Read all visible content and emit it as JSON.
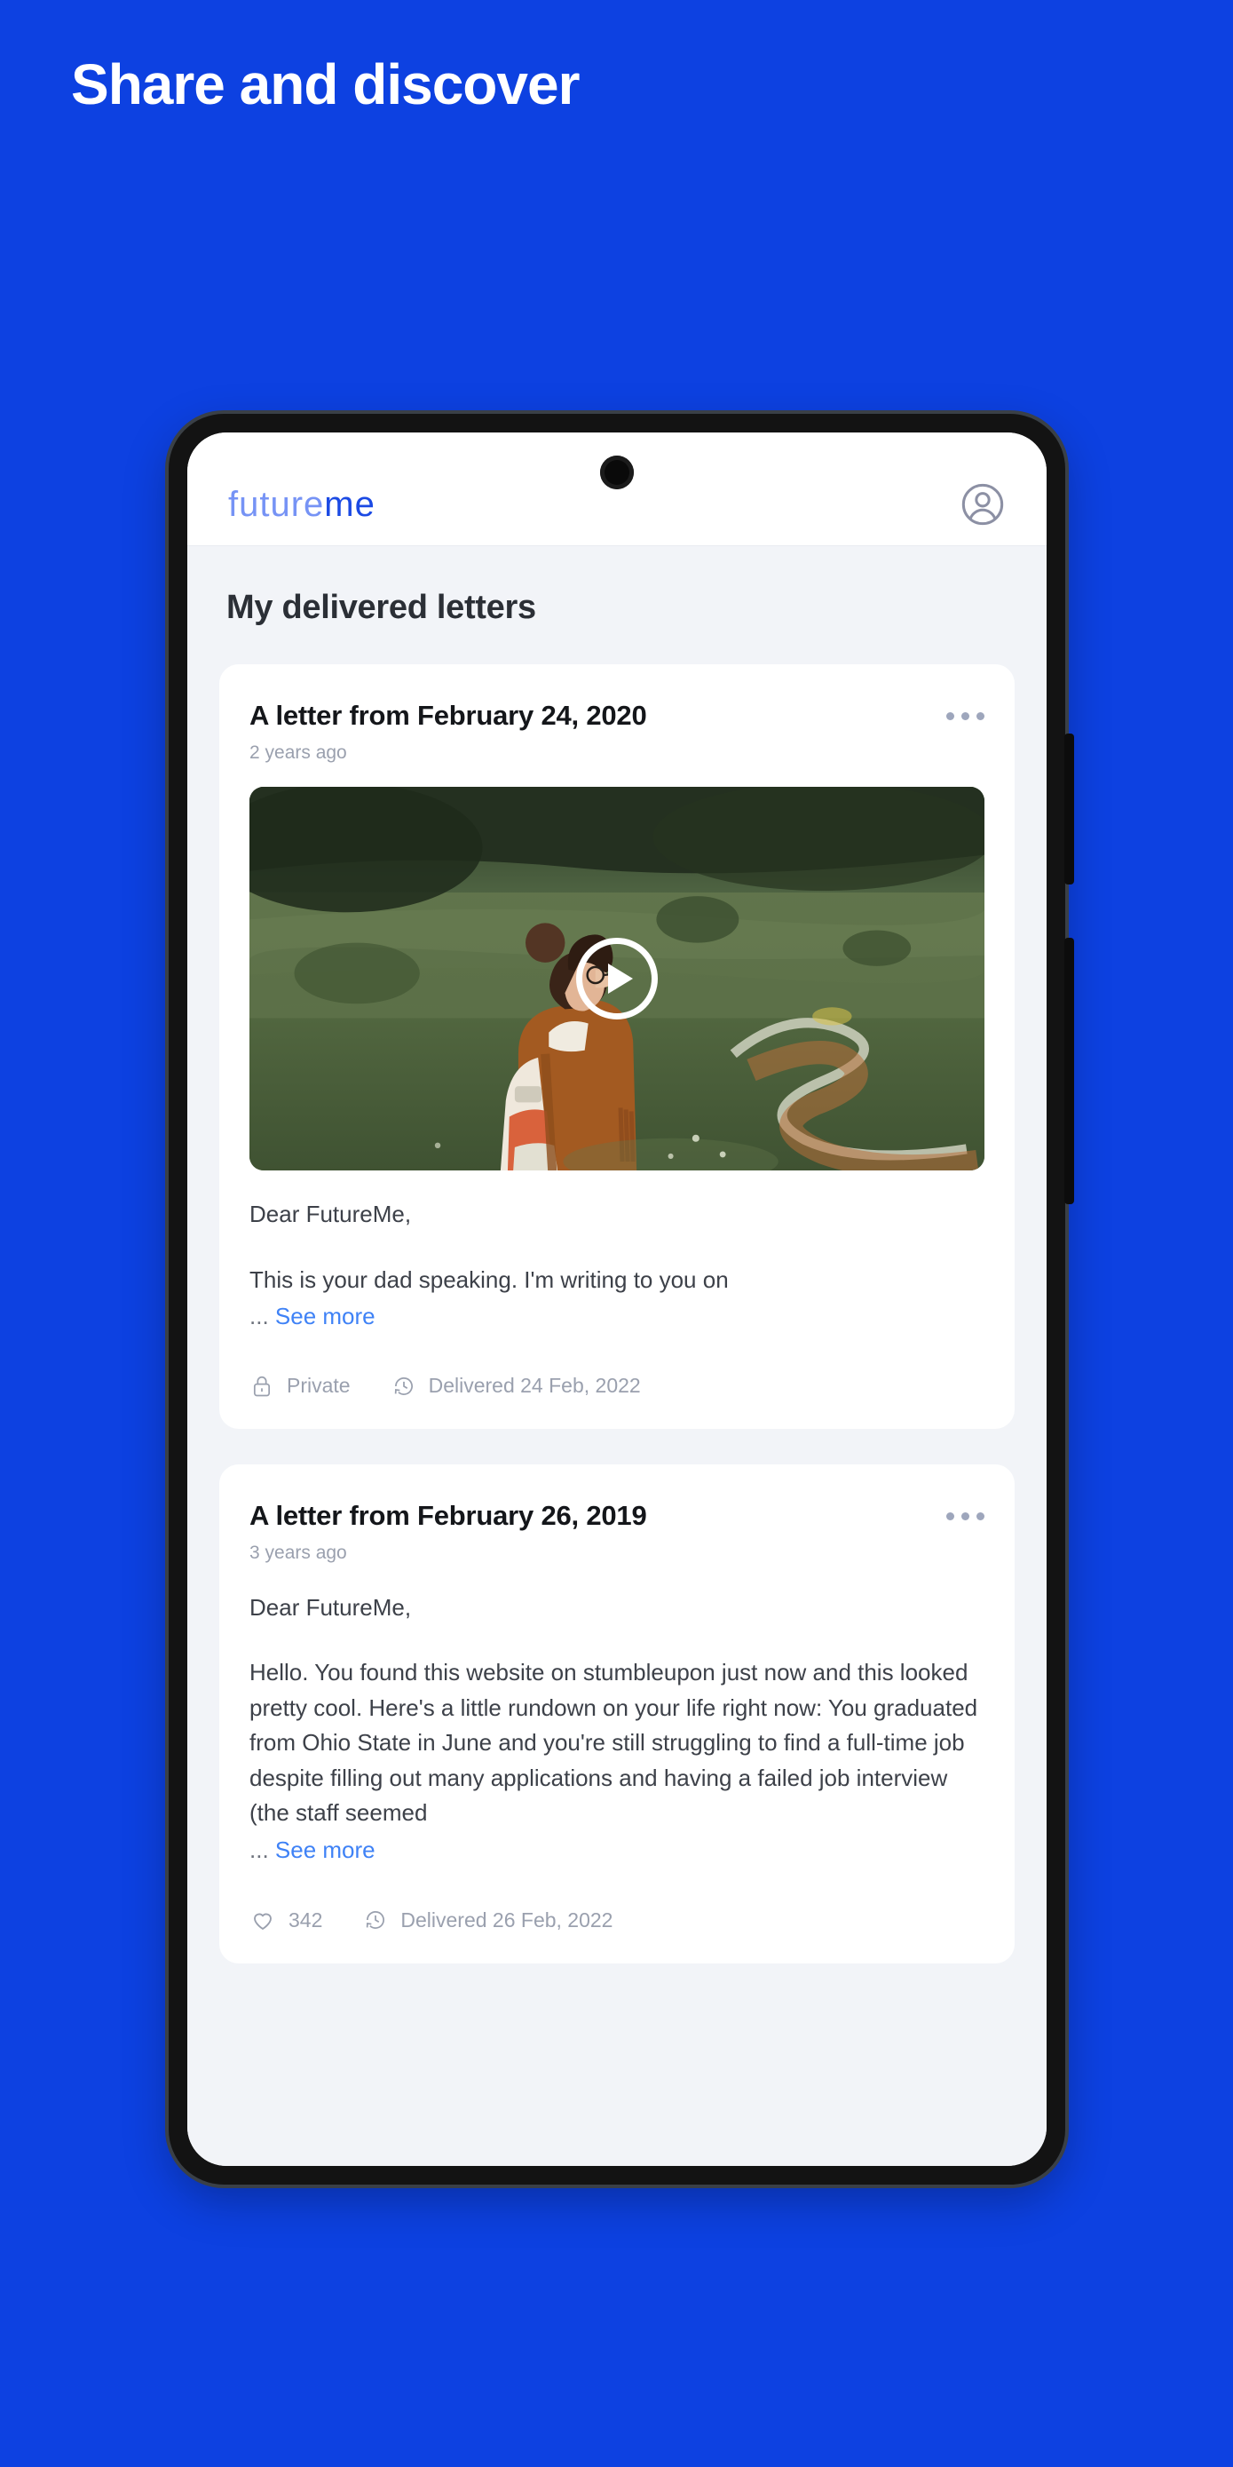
{
  "poster": {
    "headline": "Share and discover",
    "background_color": "#0D41E1"
  },
  "app": {
    "logo": {
      "part_light": "future",
      "part_bold": "me",
      "light_color": "#7693F5",
      "bold_color": "#1B4AE4"
    },
    "account_icon": "account-circle-icon",
    "page_title": "My delivered letters",
    "accent_link_color": "#3F82F6",
    "muted_text_color": "#9AA0AE"
  },
  "letters": [
    {
      "title": "A letter from February 24, 2020",
      "age": "2 years ago",
      "has_video": true,
      "video_icon": "play-circle-icon",
      "greeting": "Dear FutureMe,",
      "excerpt": "This is your dad speaking. I'm writing to you on",
      "ellipsis": "...",
      "see_more": "See more",
      "privacy_icon": "lock-icon",
      "privacy": "Private",
      "delivered_icon": "clock-history-icon",
      "delivered": "Delivered 24 Feb, 2022"
    },
    {
      "title": "A letter from February 26, 2019",
      "age": "3 years ago",
      "has_video": false,
      "greeting": "Dear FutureMe,",
      "excerpt": "Hello. You found this website on stumbleupon just now and this looked pretty cool. Here's a little rundown on your life right now: You graduated from Ohio State in June and you're still struggling to find a full-time job despite filling out many applications and having a failed job interview (the staff seemed",
      "ellipsis": "...",
      "see_more": "See more",
      "likes_icon": "heart-icon",
      "likes": "342",
      "delivered_icon": "clock-history-icon",
      "delivered": "Delivered 26 Feb, 2022"
    }
  ]
}
